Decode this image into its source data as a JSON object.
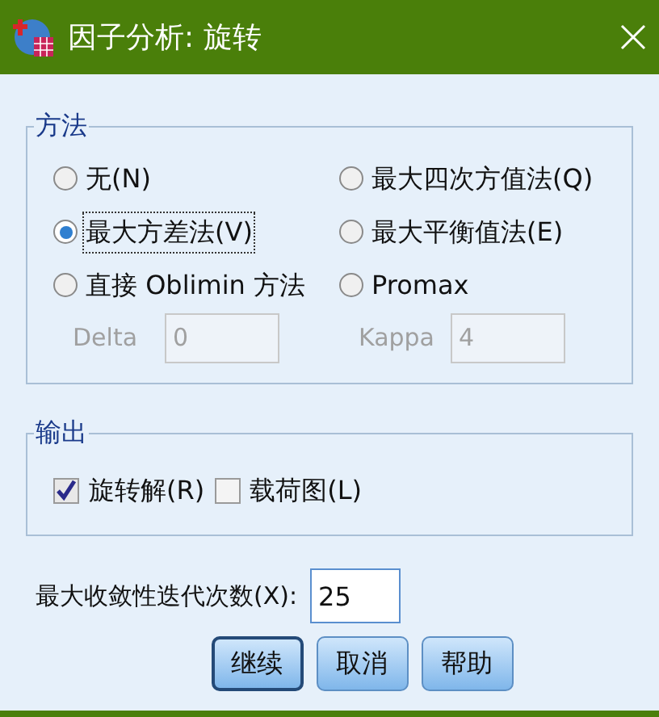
{
  "window": {
    "title": "因子分析: 旋转"
  },
  "method": {
    "legend": "方法",
    "options": [
      {
        "label": "无(N)",
        "selected": false
      },
      {
        "label": "最大四次方值法(Q)",
        "selected": false
      },
      {
        "label": "最大方差法(V)",
        "selected": true
      },
      {
        "label": "最大平衡值法(E)",
        "selected": false
      },
      {
        "label": "直接 Oblimin 方法",
        "selected": false
      },
      {
        "label": "Promax",
        "selected": false
      }
    ],
    "params": [
      {
        "label": "Delta",
        "value": "0",
        "disabled": true
      },
      {
        "label": "Kappa",
        "value": "4",
        "disabled": true
      }
    ]
  },
  "output": {
    "legend": "输出",
    "checkboxes": [
      {
        "label": "旋转解(R)",
        "checked": true
      },
      {
        "label": "载荷图(L)",
        "checked": false
      }
    ]
  },
  "iterations": {
    "label": "最大收敛性迭代次数(X):",
    "value": "25"
  },
  "buttons": [
    {
      "label": "继续",
      "default": true
    },
    {
      "label": "取消",
      "default": false
    },
    {
      "label": "帮助",
      "default": false
    }
  ]
}
